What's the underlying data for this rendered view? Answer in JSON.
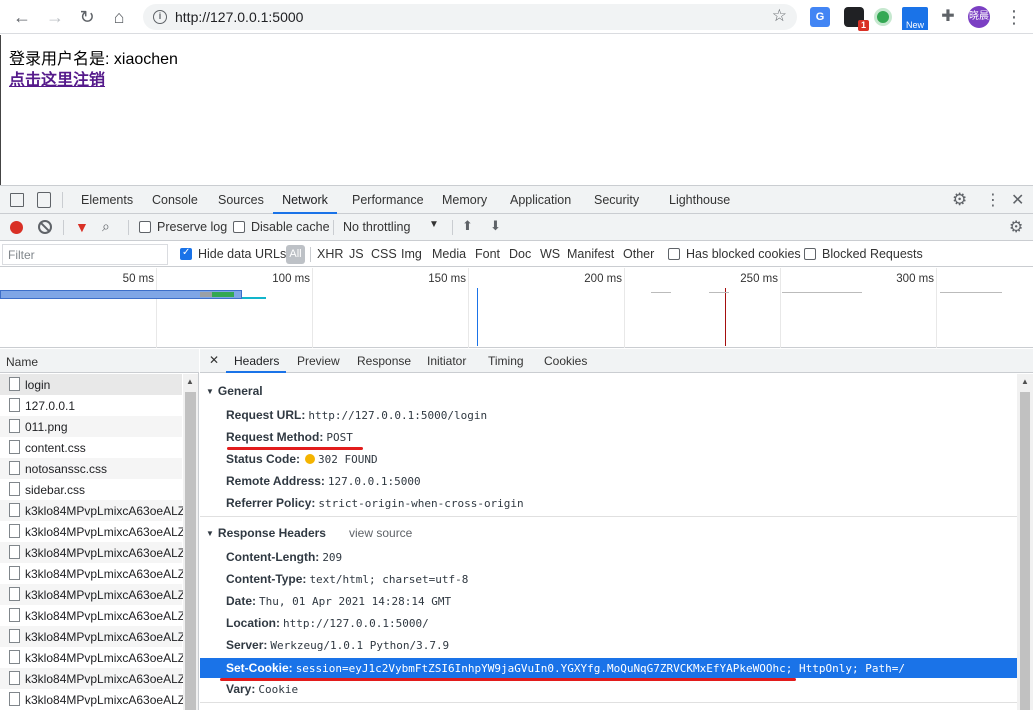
{
  "browser": {
    "url": "http://127.0.0.1:5000",
    "back_icon": "arrow-left-icon",
    "forward_icon": "arrow-right-icon",
    "reload_icon": "reload-icon",
    "home_icon": "home-icon",
    "ext_badge": "1",
    "ext_new_label": "New",
    "avatar_label": "晓晨"
  },
  "page": {
    "user_text": "登录用户名是: xiaochen",
    "logout_link": "点击这里注销"
  },
  "devtools": {
    "tabs": [
      "Elements",
      "Console",
      "Sources",
      "Network",
      "Performance",
      "Memory",
      "Application",
      "Security",
      "Lighthouse"
    ],
    "active_tab": "Network",
    "toolbar": {
      "preserve_log": "Preserve log",
      "disable_cache": "Disable cache",
      "throttling": "No throttling"
    },
    "filter": {
      "placeholder": "Filter",
      "hide_data_urls": "Hide data URLs",
      "all": "All",
      "types": [
        "XHR",
        "JS",
        "CSS",
        "Img",
        "Media",
        "Font",
        "Doc",
        "WS",
        "Manifest",
        "Other"
      ],
      "has_blocked_cookies": "Has blocked cookies",
      "blocked_requests": "Blocked Requests"
    },
    "overview_ticks": [
      "50 ms",
      "100 ms",
      "150 ms",
      "200 ms",
      "250 ms",
      "300 ms"
    ],
    "requests": {
      "header": "Name",
      "items": [
        "login",
        "127.0.0.1",
        "011.png",
        "content.css",
        "notosanssc.css",
        "sidebar.css",
        "k3klo84MPvpLmixcA63oeALZ",
        "k3klo84MPvpLmixcA63oeALZ",
        "k3klo84MPvpLmixcA63oeALZ",
        "k3klo84MPvpLmixcA63oeALZ",
        "k3klo84MPvpLmixcA63oeALZ",
        "k3klo84MPvpLmixcA63oeALZ",
        "k3klo84MPvpLmixcA63oeALZ",
        "k3klo84MPvpLmixcA63oeALZ",
        "k3klo84MPvpLmixcA63oeALZ",
        "k3klo84MPvpLmixcA63oeALZ"
      ]
    },
    "detail_tabs": [
      "Headers",
      "Preview",
      "Response",
      "Initiator",
      "Timing",
      "Cookies"
    ],
    "general": {
      "title": "General",
      "request_url_k": "Request URL:",
      "request_url_v": "http://127.0.0.1:5000/login",
      "request_method_k": "Request Method:",
      "request_method_v": "POST",
      "status_code_k": "Status Code:",
      "status_code_v": "302 FOUND",
      "remote_address_k": "Remote Address:",
      "remote_address_v": "127.0.0.1:5000",
      "referrer_policy_k": "Referrer Policy:",
      "referrer_policy_v": "strict-origin-when-cross-origin"
    },
    "response_headers": {
      "title": "Response Headers",
      "view_source": "view source",
      "content_length_k": "Content-Length:",
      "content_length_v": "209",
      "content_type_k": "Content-Type:",
      "content_type_v": "text/html; charset=utf-8",
      "date_k": "Date:",
      "date_v": "Thu, 01 Apr 2021 14:28:14 GMT",
      "location_k": "Location:",
      "location_v": "http://127.0.0.1:5000/",
      "server_k": "Server:",
      "server_v": "Werkzeug/1.0.1 Python/3.7.9",
      "set_cookie_k": "Set-Cookie:",
      "set_cookie_v": "session=eyJ1c2VybmFtZSI6InhpYW9jaGVuIn0.YGXYfg.MoQuNqG7ZRVCKMxEfYAPkeWOOhc; HttpOnly; Path=/",
      "vary_k": "Vary:",
      "vary_v": "Cookie"
    },
    "colors": {
      "accent": "#1a73e8",
      "annotation_red": "#e21c1c"
    }
  }
}
